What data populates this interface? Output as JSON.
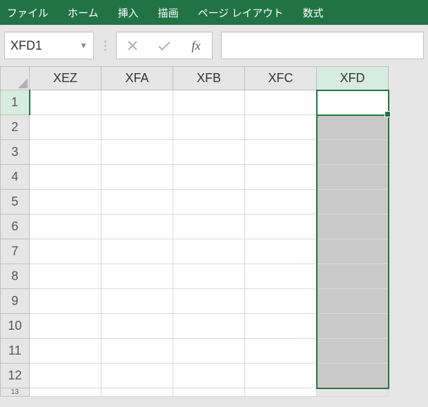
{
  "ribbon": {
    "tabs": [
      "ファイル",
      "ホーム",
      "挿入",
      "描画",
      "ページ レイアウト",
      "数式"
    ]
  },
  "nameBox": {
    "value": "XFD1"
  },
  "formulaBar": {
    "fx_label": "fx",
    "value": ""
  },
  "columns": [
    "XEZ",
    "XFA",
    "XFB",
    "XFC",
    "XFD"
  ],
  "rows": [
    "1",
    "2",
    "3",
    "4",
    "5",
    "6",
    "7",
    "8",
    "9",
    "10",
    "11",
    "12",
    "13"
  ],
  "selectedColumn": "XFD",
  "selectedRow": "1"
}
